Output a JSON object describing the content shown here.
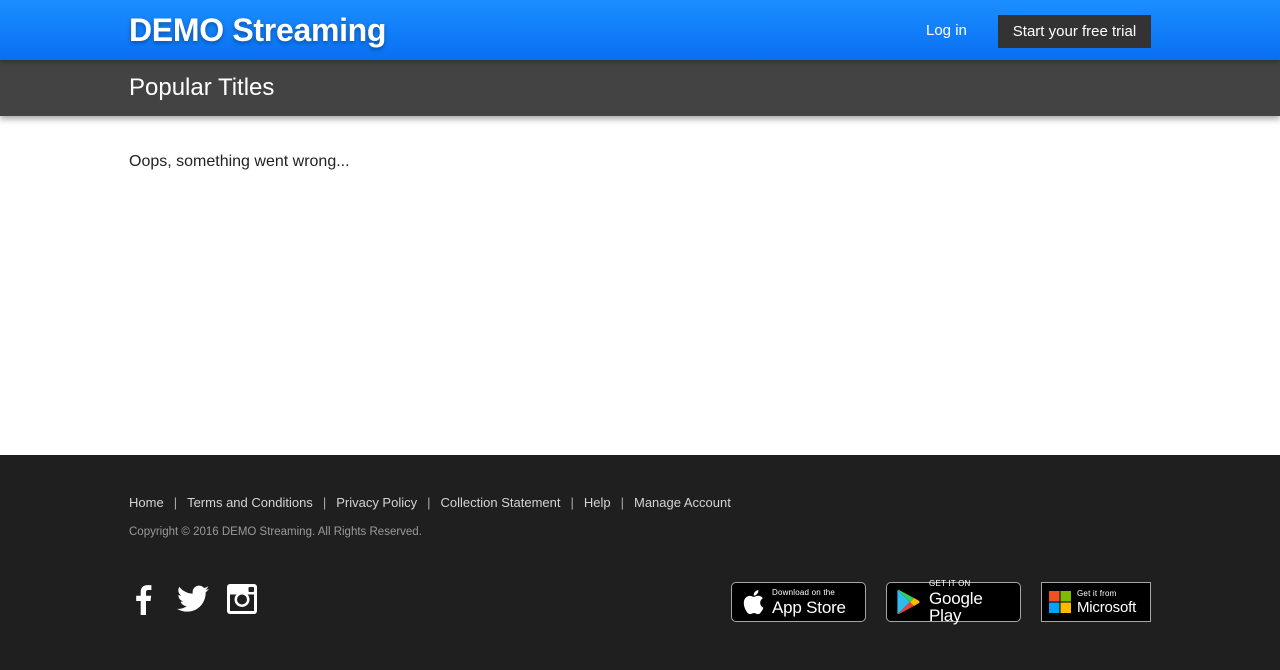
{
  "header": {
    "brand": "DEMO Streaming",
    "login_label": "Log in",
    "trial_label": "Start your free trial"
  },
  "subheader": {
    "title": "Popular Titles"
  },
  "main": {
    "error_message": "Oops, something went wrong..."
  },
  "footer": {
    "links": [
      "Home",
      "Terms and Conditions",
      "Privacy Policy",
      "Collection Statement",
      "Help",
      "Manage Account"
    ],
    "separator": "|",
    "copyright": "Copyright © 2016 DEMO Streaming. All Rights Reserved.",
    "social": [
      {
        "name": "facebook",
        "icon": "facebook-icon"
      },
      {
        "name": "twitter",
        "icon": "twitter-icon"
      },
      {
        "name": "instagram",
        "icon": "instagram-icon"
      }
    ],
    "stores": {
      "app_store": {
        "small": "Download on the",
        "big": "App Store",
        "icon": "apple-icon"
      },
      "google_play": {
        "small": "GET IT ON",
        "big": "Google Play",
        "icon": "google-play-icon"
      },
      "microsoft": {
        "small": "Get it from",
        "big": "Microsoft",
        "icon": "microsoft-icon"
      }
    }
  },
  "colors": {
    "header_blue": "#0a6ff2",
    "subheader_gray": "#434343",
    "footer_dark": "#1f1f1f",
    "trial_button": "#333333"
  }
}
